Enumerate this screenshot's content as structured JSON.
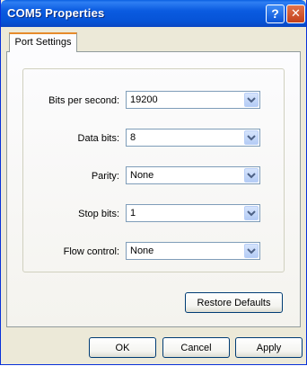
{
  "window": {
    "title": "COM5 Properties"
  },
  "titlebar": {
    "help_label": "?",
    "close_label": "✕"
  },
  "tabs": [
    {
      "label": "Port Settings"
    }
  ],
  "fields": [
    {
      "label": "Bits per second:",
      "value": "19200"
    },
    {
      "label": "Data bits:",
      "value": "8"
    },
    {
      "label": "Parity:",
      "value": "None"
    },
    {
      "label": "Stop bits:",
      "value": "1"
    },
    {
      "label": "Flow control:",
      "value": "None"
    }
  ],
  "buttons": {
    "restore_defaults": "Restore Defaults",
    "ok": "OK",
    "cancel": "Cancel",
    "apply": "Apply"
  }
}
